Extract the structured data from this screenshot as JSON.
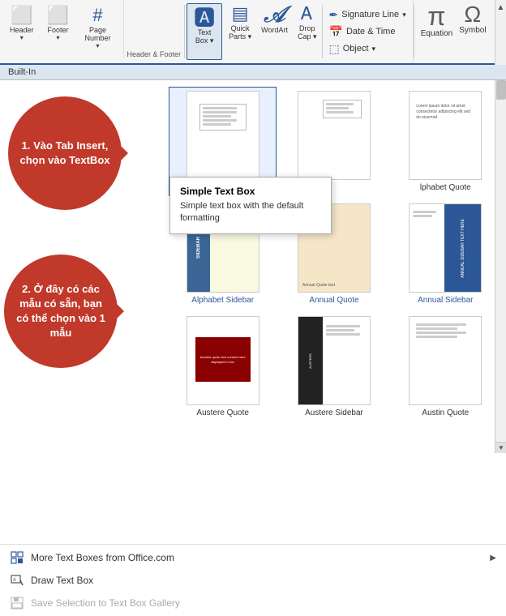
{
  "ribbon": {
    "header_label": "Header & Footer",
    "built_in": "Built-In",
    "textbox_label": "Text\nBox",
    "quick_parts": "Quick\nParts",
    "wordart": "WordArt",
    "drop_cap": "Drop\nCap",
    "header": "Header",
    "footer": "Footer",
    "page_number": "Page\nNumber",
    "signature_line": "Signature Line",
    "date_time": "Date & Time",
    "object": "Object",
    "equation": "Equation",
    "symbol": "Symbol"
  },
  "balloons": {
    "b1": "1. Vào Tab Insert, chọn vào TextBox",
    "b2": "2. Ở đây có các mẫu có sẵn, bạn có thể chọn vào 1 mẫu"
  },
  "gallery": {
    "items": [
      {
        "label": "Simple Text Bo...",
        "type": "simple-text",
        "color": "#333"
      },
      {
        "label": "",
        "type": "empty-top-right",
        "color": "#333"
      },
      {
        "label": "lphabet Quote",
        "type": "alphabet-quote",
        "color": "#333"
      },
      {
        "label": "Alphabet Sidebar",
        "type": "alphabet-sidebar",
        "color": "#2b579a"
      },
      {
        "label": "Annual Quote",
        "type": "annual-quote",
        "color": "#2b579a"
      },
      {
        "label": "Annual Sidebar",
        "type": "annual-sidebar",
        "color": "#2b579a"
      },
      {
        "label": "Austere Quote",
        "type": "austere-quote",
        "color": "#333"
      },
      {
        "label": "Austere Sidebar",
        "type": "austere-sidebar",
        "color": "#333"
      },
      {
        "label": "Austin Quote",
        "type": "austin-quote",
        "color": "#333"
      }
    ]
  },
  "tooltip": {
    "title": "Simple Text Box",
    "desc": "Simple text box with the default formatting"
  },
  "bottom_menu": {
    "items": [
      {
        "label": "More Text Boxes from Office.com",
        "icon": "🗂",
        "has_arrow": true,
        "disabled": false
      },
      {
        "label": "Draw Text Box",
        "icon": "✏",
        "has_arrow": false,
        "disabled": false
      },
      {
        "label": "Save Selection to Text Box Gallery",
        "icon": "💾",
        "has_arrow": false,
        "disabled": true
      }
    ]
  }
}
